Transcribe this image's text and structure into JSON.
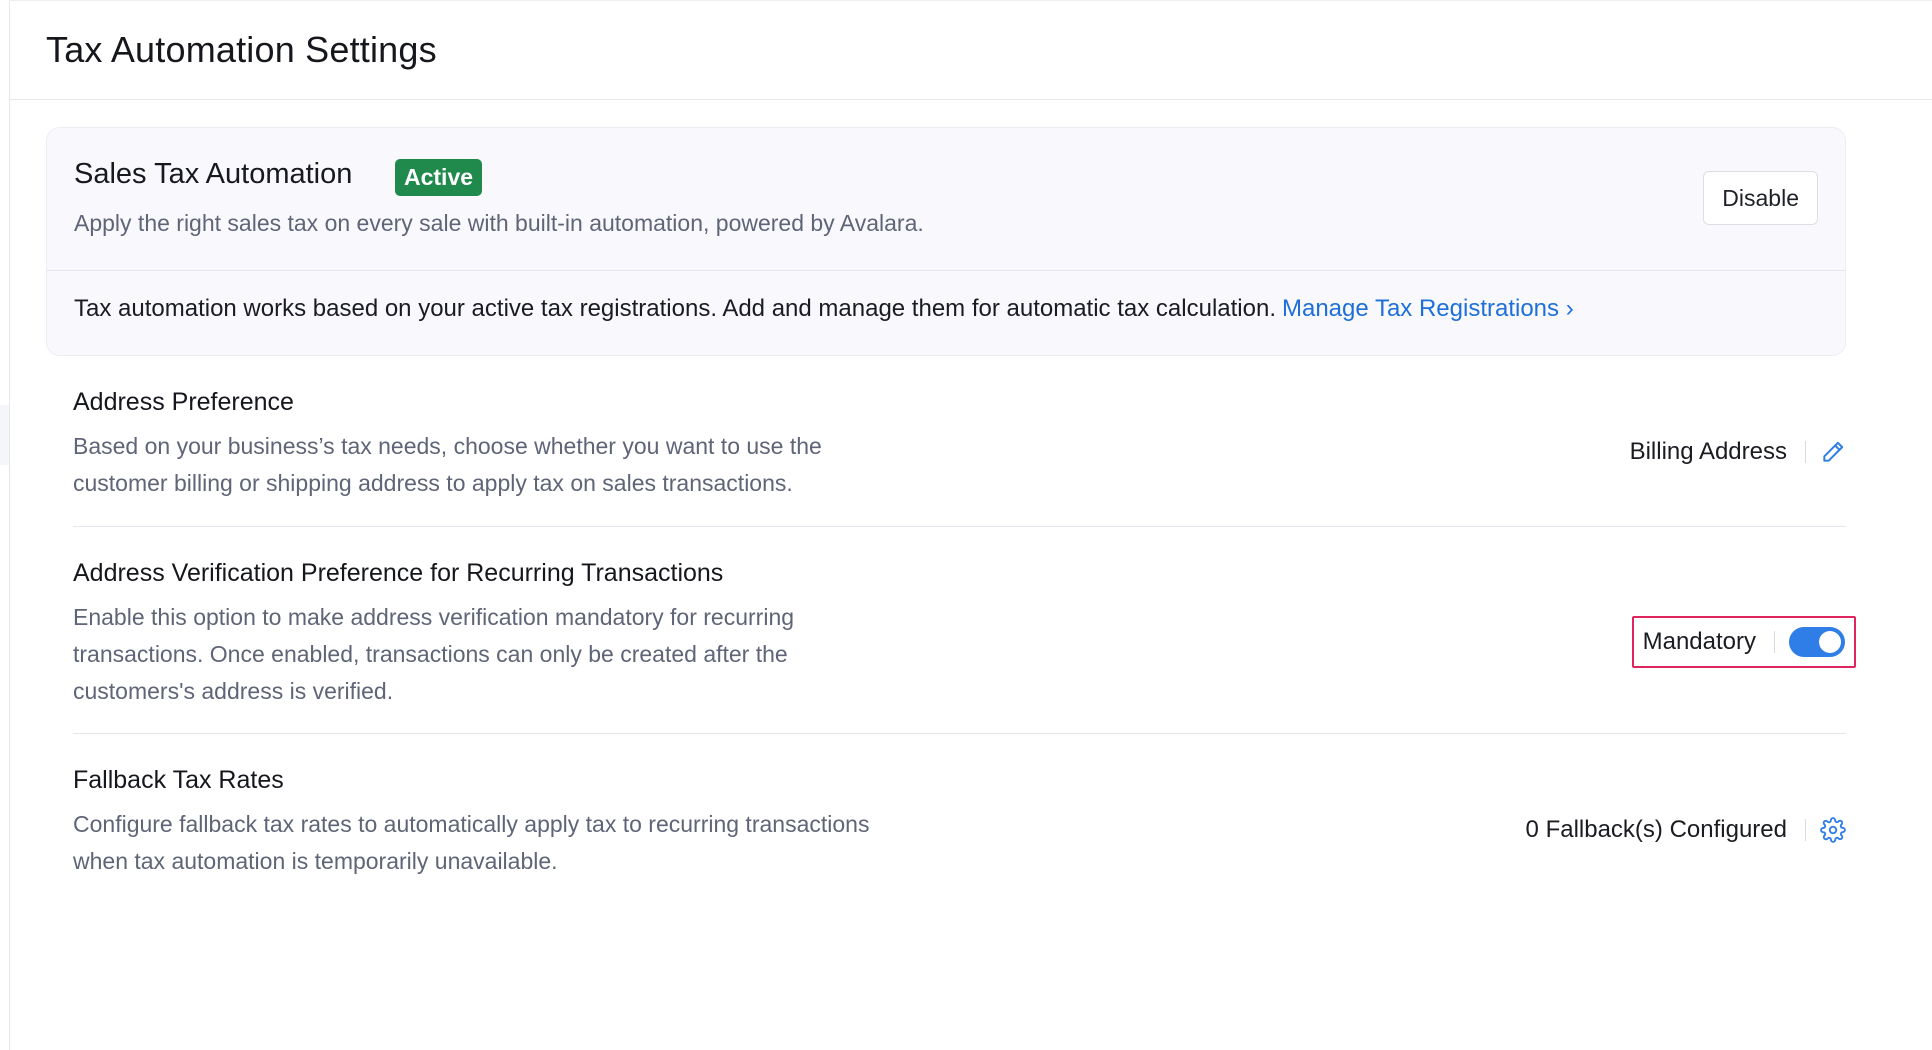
{
  "header": {
    "title": "Tax Automation Settings"
  },
  "automation_card": {
    "title": "Sales Tax Automation",
    "status_badge": "Active",
    "description": "Apply the right sales tax on every sale with built-in automation, powered by Avalara.",
    "disable_label": "Disable",
    "note": "Tax automation works based on your active tax registrations. Add and manage them for automatic tax calculation.",
    "manage_link": "Manage Tax Registrations ›"
  },
  "sections": {
    "address_preference": {
      "title": "Address Preference",
      "description_line1": "Based on your business’s tax needs, choose whether you want to use the",
      "description_line2": "customer billing or shipping address to apply tax on sales transactions.",
      "value": "Billing Address",
      "action_icon": "pencil-icon"
    },
    "address_verification": {
      "title": "Address Verification Preference for Recurring Transactions",
      "description_line1": "Enable this option to make address verification mandatory for recurring",
      "description_line2": "transactions. Once enabled, transactions can only be created after the",
      "description_line3": "customers's address is verified.",
      "toggle_label": "Mandatory",
      "toggle_on": true
    },
    "fallback_rates": {
      "title": "Fallback Tax Rates",
      "description_line1": "Configure fallback tax rates to automatically apply tax to recurring transactions",
      "description_line2": "when tax automation is temporarily unavailable.",
      "value": "0 Fallback(s) Configured",
      "action_icon": "gear-icon"
    }
  },
  "colors": {
    "accent": "#2f7de6",
    "link": "#1e6fd9",
    "badge_bg": "#1f8a4c",
    "highlight": "#e0245e"
  }
}
